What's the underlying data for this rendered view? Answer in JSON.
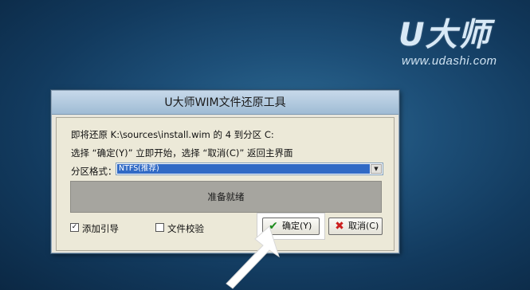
{
  "brand": {
    "logo_text": "U大师",
    "url": "www.udashi.com"
  },
  "dialog": {
    "title": "U大师WIM文件还原工具",
    "info_line": "即将还原 K:\\sources\\install.wim 的 4 到分区 C:",
    "hint_line": "选择 “确定(Y)” 立即开始，选择 “取消(C)” 返回主界面",
    "format_label": "分区格式：",
    "format_value": "NTFS(推荐)",
    "status": "准备就绪",
    "checkbox_guide": {
      "label": "添加引导",
      "checked": true
    },
    "checkbox_verify": {
      "label": "文件校验",
      "checked": false
    },
    "ok_label": "确定(Y)",
    "cancel_label": "取消(C)"
  },
  "colors": {
    "selection": "#316ac5",
    "ok_icon": "#1c8a1c",
    "cancel_icon": "#cc1f1f"
  },
  "icons": [
    "checkmark-icon",
    "x-icon",
    "dropdown-arrow-icon",
    "pointer-arrow-icon"
  ]
}
